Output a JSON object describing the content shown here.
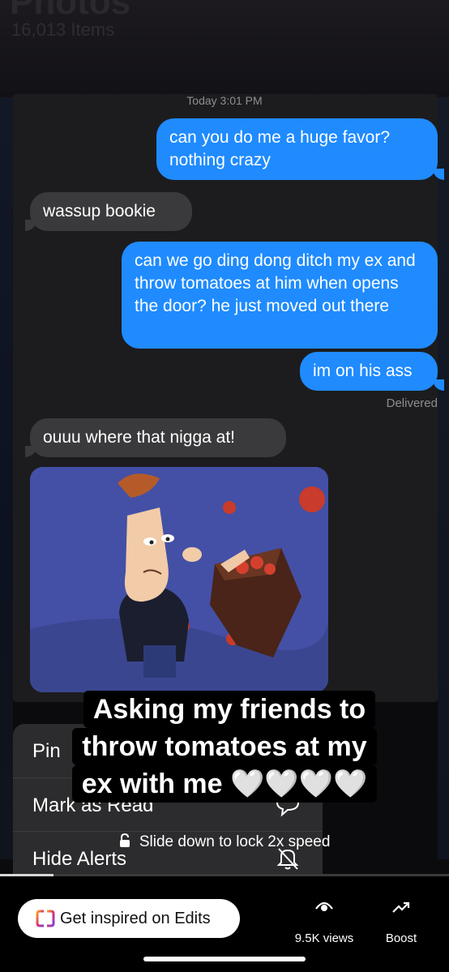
{
  "background_app": {
    "title": "Photos",
    "item_count": "16,013 Items"
  },
  "messages": {
    "timestamp": "Today 3:01 PM",
    "bubbles": [
      {
        "from": "me",
        "text": "can you do me a huge favor? nothing crazy"
      },
      {
        "from": "them",
        "text": "wassup bookie"
      },
      {
        "from": "me",
        "text": "can we go ding dong ditch my ex and throw tomatoes at him when opens the door? he just moved out there"
      },
      {
        "from": "me",
        "text": "im on his ass"
      },
      {
        "from": "them",
        "text": "ouuu where that nigga at!"
      }
    ],
    "delivered_label": "Delivered"
  },
  "context_menu": {
    "items": [
      {
        "label": "Pin",
        "icon": "pin-icon"
      },
      {
        "label": "Mark as Read",
        "icon": "chat-bubble-icon"
      },
      {
        "label": "Hide Alerts",
        "icon": "bell-slash-icon"
      }
    ]
  },
  "caption": {
    "lines": [
      "Asking my friends to",
      "throw tomatoes at my",
      "ex with me 🤍🤍🤍🤍"
    ]
  },
  "speed_hint": {
    "text": "Slide down to lock 2x speed",
    "icon": "lock-icon"
  },
  "playback": {
    "progress": 0.12
  },
  "bottom_bar": {
    "edits_label": "Get inspired on Edits",
    "edits_icon": "edits-logo-icon",
    "views_label": "9.5K views",
    "views_icon": "eye-icon",
    "boost_label": "Boost",
    "boost_icon": "trend-up-icon"
  },
  "colors": {
    "sent_bubble": "#1f8bff",
    "received_bubble": "#3a3a3c",
    "gif_background": "#4350a6"
  }
}
